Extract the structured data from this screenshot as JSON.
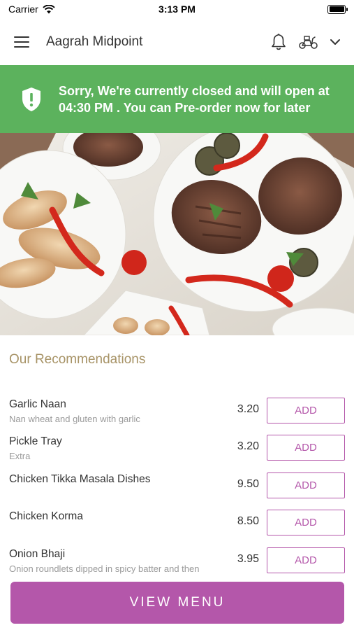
{
  "status_bar": {
    "carrier": "Carrier",
    "time": "3:13 PM"
  },
  "header": {
    "title": "Aagrah Midpoint"
  },
  "banner": {
    "message": "Sorry, We're currently closed and will open at 04:30 PM . You can Pre-order now for later",
    "color": "#5cb25d"
  },
  "recommendations": {
    "title": "Our Recommendations",
    "items": [
      {
        "name": "Garlic Naan",
        "description": "Nan wheat and gluten with garlic",
        "price": "3.20",
        "add_label": "ADD"
      },
      {
        "name": "Pickle Tray",
        "description": "Extra",
        "price": "3.20",
        "add_label": "ADD"
      },
      {
        "name": "Chicken Tikka Masala Dishes",
        "description": "",
        "price": "9.50",
        "add_label": "ADD"
      },
      {
        "name": "Chicken Korma",
        "description": "",
        "price": "8.50",
        "add_label": "ADD"
      },
      {
        "name": "Onion Bhaji",
        "description": "Onion roundlets dipped in spicy batter and then",
        "price": "3.95",
        "add_label": "ADD"
      }
    ]
  },
  "footer": {
    "view_menu_label": "VIEW MENU"
  },
  "colors": {
    "accent": "#b457aa",
    "section_title": "#a79366"
  },
  "icons": [
    "hamburger-icon",
    "bell-icon",
    "scooter-icon",
    "chevron-down-icon",
    "shield-icon"
  ]
}
